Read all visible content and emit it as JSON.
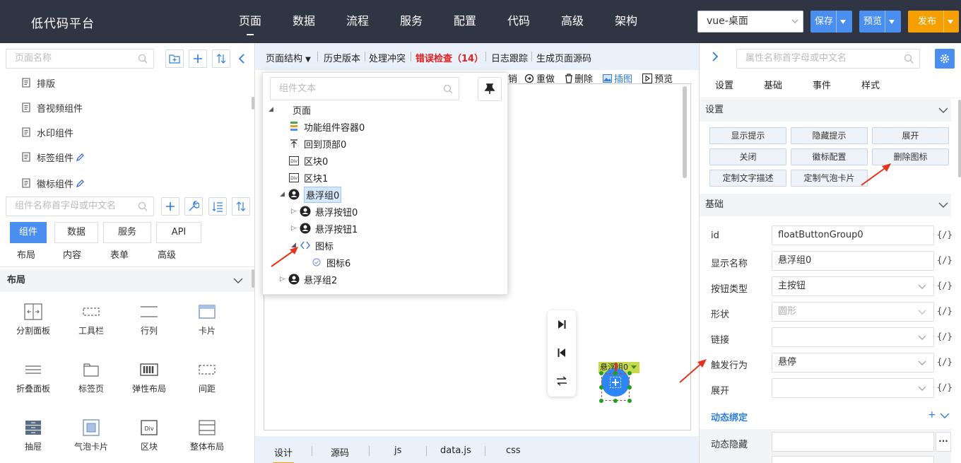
{
  "app": {
    "title": "低代码平台",
    "nav": [
      "页面",
      "数据",
      "流程",
      "服务",
      "配置",
      "代码",
      "高级",
      "架构"
    ],
    "env": "vue-桌面",
    "save": "保存",
    "preview": "预览",
    "publish": "发布"
  },
  "left": {
    "page_search_placeholder": "页面名称",
    "pages": [
      "排版",
      "音视频组件",
      "水印组件",
      "标签组件",
      "徽标组件"
    ],
    "comp_search_placeholder": "组件名称首字母或中文名",
    "tabs": [
      "组件",
      "数据",
      "服务",
      "API"
    ],
    "subtabs": [
      "布局",
      "内容",
      "表单",
      "高级"
    ],
    "section": "布局",
    "components": [
      "分割面板",
      "工具栏",
      "行列",
      "卡片",
      "折叠面板",
      "标签页",
      "弹性布局",
      "间距",
      "抽屉",
      "气泡卡片",
      "区块",
      "整体布局"
    ]
  },
  "center": {
    "toolbar": {
      "structure": "页面结构",
      "history": "历史版本",
      "conflict": "处理冲突",
      "errors": "错误检查（14）",
      "log": "日志跟踪",
      "source": "生成页面源码"
    },
    "toolbar2": {
      "undo_tail": "销",
      "redo": "重做",
      "delete": "删除",
      "image": "插图",
      "preview": "预览"
    },
    "float_label": "悬浮组0",
    "bottom_tabs": [
      "设计",
      "源码",
      "js",
      "data.js",
      "css"
    ]
  },
  "tree": {
    "search_placeholder": "组件文本",
    "nodes": [
      "页面",
      "功能组件容器0",
      "回到顶部0",
      "区块0",
      "区块1",
      "悬浮组0",
      "悬浮按钮0",
      "悬浮按钮1",
      "图标",
      "图标6",
      "悬浮组2"
    ]
  },
  "right": {
    "search_placeholder": "属性名称首字母或中文名",
    "tabs": [
      "设置",
      "基础",
      "事件",
      "样式"
    ],
    "settings_title": "设置",
    "actions": [
      "显示提示",
      "隐藏提示",
      "展开",
      "关闭",
      "徽标配置",
      "删除图标",
      "定制文字描述",
      "定制气泡卡片"
    ],
    "basic_title": "基础",
    "props": [
      {
        "label": "id",
        "value": "floatButtonGroup0",
        "code": "{/}"
      },
      {
        "label": "显示名称",
        "value": "悬浮组0",
        "code": "{/}"
      },
      {
        "label": "按钮类型",
        "value": "主按钮",
        "code": "{/}"
      },
      {
        "label": "形状",
        "value": "圆形",
        "code": "{/}"
      },
      {
        "label": "链接",
        "value": "",
        "code": "{/}"
      },
      {
        "label": "触发行为",
        "value": "悬停",
        "code": "{/}"
      },
      {
        "label": "展开",
        "value": "",
        "code": "{/}"
      }
    ],
    "dynamic_title": "动态绑定",
    "dynamic_plus": "+",
    "dynamic_hidden": "动态隐藏",
    "dynamic_more": "···"
  },
  "colors": {
    "topbar": "#2f3542",
    "primary": "#4a8ef0",
    "publish": "#f5a000",
    "error": "#e02020",
    "arrow": "#e8321e"
  }
}
